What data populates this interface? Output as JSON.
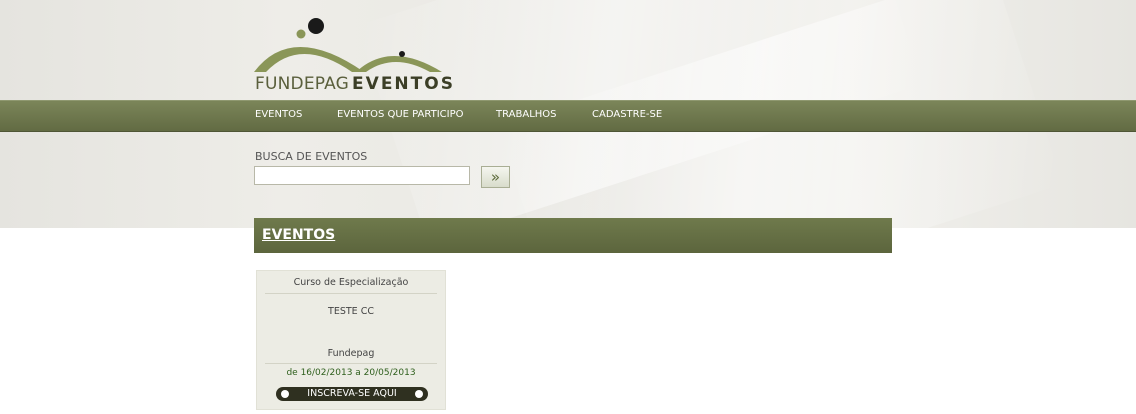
{
  "logo": {
    "text_light": "FUNDEPAG",
    "text_bold": "EVENTOS"
  },
  "nav": {
    "items": [
      {
        "label": "EVENTOS"
      },
      {
        "label": "EVENTOS QUE PARTICIPO"
      },
      {
        "label": "TRABALHOS"
      },
      {
        "label": "CADASTRE-SE"
      }
    ]
  },
  "search": {
    "label": "BUSCA DE EVENTOS",
    "value": "",
    "button_glyph": "»"
  },
  "section": {
    "title": "EVENTOS"
  },
  "events": [
    {
      "type": "Curso de Especialização",
      "name": "TESTE CC",
      "organizer": "Fundepag",
      "dates": "de 16/02/2013 a 20/05/2013",
      "button": "INSCREVA-SE AQUI"
    }
  ],
  "colors": {
    "nav_bg": "#6b7449",
    "section_bg": "#636c42",
    "card_bg": "#ecece4",
    "date_text": "#2e5f1c",
    "button_bg": "#2f3020"
  }
}
